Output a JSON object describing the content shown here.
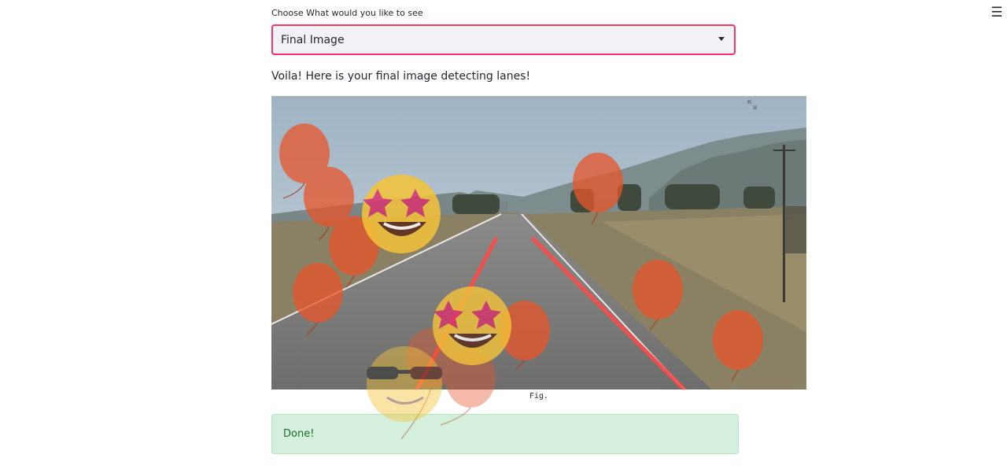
{
  "menu": {
    "icon": "hamburger-menu-icon",
    "glyph": "☰"
  },
  "selector": {
    "label": "Choose What would you like to see",
    "value": "Final Image",
    "icon": "chevron-down-icon",
    "accent_color": "#f63366"
  },
  "message": "Voila! Here is your final image detecting lanes!",
  "figure": {
    "caption": "Fig.",
    "expand_icon": "expand-icon",
    "lane_color": "#ff4a4a"
  },
  "status": {
    "text": "Done!",
    "background": "#d4f0dc"
  },
  "celebration": {
    "balloon_color": "#e8552a",
    "icons": [
      "balloon-icon",
      "star-struck-emoji-icon",
      "sunglasses-emoji-icon"
    ]
  }
}
